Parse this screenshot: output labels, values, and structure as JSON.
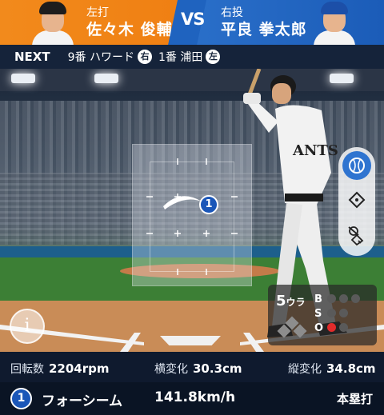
{
  "matchup": {
    "batter": {
      "hand": "左打",
      "name": "佐々木 俊輔"
    },
    "vs": "VS",
    "pitcher": {
      "hand": "右投",
      "name": "平良 拳太郎"
    }
  },
  "next": {
    "label": "NEXT",
    "batters": [
      {
        "order": "9番 ハワード",
        "side": "右"
      },
      {
        "order": "1番 浦田",
        "side": "左"
      }
    ]
  },
  "pitch_marker": "1",
  "count": {
    "inning": "5",
    "half": "ウラ",
    "b": "B",
    "s": "S",
    "o": "O"
  },
  "tools": [
    "ball-track-icon",
    "field-icon",
    "fielder-icon"
  ],
  "metrics": [
    {
      "label": "回転数",
      "value": "2204rpm"
    },
    {
      "label": "横変化",
      "value": "30.3cm"
    },
    {
      "label": "縦変化",
      "value": "34.8cm"
    }
  ],
  "pitch": {
    "number": "1",
    "type": "フォーシーム",
    "speed": "141.8km/h",
    "result": "本塁打"
  },
  "colors": {
    "batter_side": "#f28a1c",
    "pitcher_side": "#2a6fc9",
    "accent": "#1a56b8"
  }
}
